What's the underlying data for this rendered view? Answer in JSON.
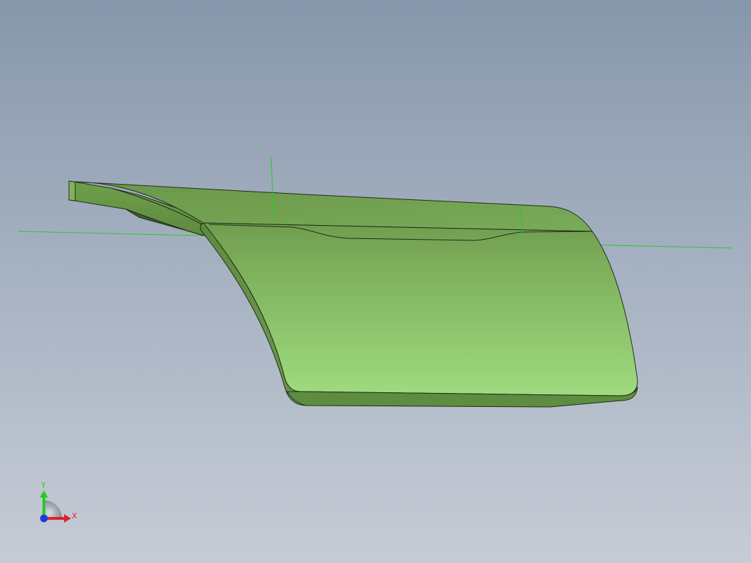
{
  "viewport": {
    "background_top": "#8797ab",
    "background_bottom": "#c6ccd6"
  },
  "model": {
    "part_icon": "door-panel-3d-icon",
    "face_color_light": "#9fdb7f",
    "face_color_dark": "#6f9d4f",
    "edge_color": "#1f2a18",
    "reference_line_color": "#22cc22"
  },
  "triad": {
    "x_label": "X",
    "y_label": "Y",
    "x_color": "#e0202a",
    "y_color": "#22cc22",
    "z_color": "#1a3cd8"
  }
}
